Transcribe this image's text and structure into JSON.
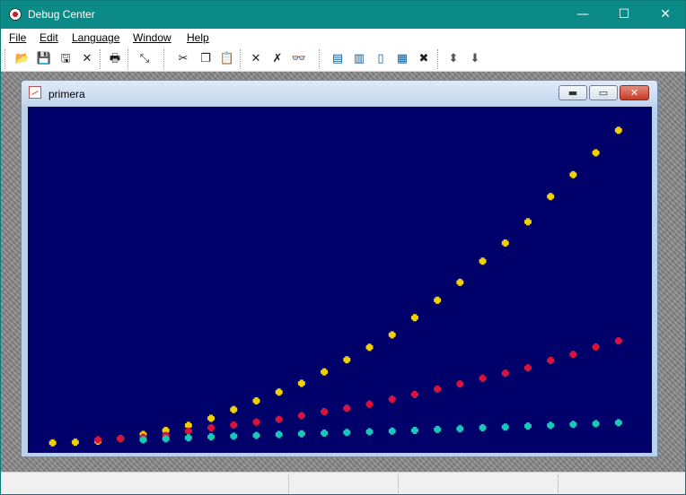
{
  "app": {
    "title": "Debug Center"
  },
  "caption_buttons": {
    "minimize": "—",
    "maximize": "☐",
    "close": "✕"
  },
  "menu": [
    {
      "label": "File"
    },
    {
      "label": "Edit"
    },
    {
      "label": "Language"
    },
    {
      "label": "Window"
    },
    {
      "label": "Help"
    }
  ],
  "toolbar": [
    {
      "name": "open-folder-icon",
      "glyph": "📂"
    },
    {
      "name": "save-icon",
      "glyph": "💾"
    },
    {
      "name": "save-all-icon",
      "glyph": "🖫"
    },
    {
      "name": "close-x-icon",
      "glyph": "✕"
    },
    {
      "name": "print-icon",
      "glyph": "🖶"
    },
    {
      "name": "pointer-icon",
      "glyph": "⤡"
    },
    {
      "name": "cut-icon",
      "glyph": "✂"
    },
    {
      "name": "copy-icon",
      "glyph": "❐"
    },
    {
      "name": "paste-icon",
      "glyph": "📋"
    },
    {
      "name": "delete-icon",
      "glyph": "✕"
    },
    {
      "name": "delete-all-icon",
      "glyph": "✗"
    },
    {
      "name": "find-icon",
      "glyph": "👓"
    },
    {
      "name": "cascade-icon",
      "glyph": "▤"
    },
    {
      "name": "tile-horizontal-icon",
      "glyph": "▥"
    },
    {
      "name": "tile-vertical-icon",
      "glyph": "▯"
    },
    {
      "name": "arrange-icon",
      "glyph": "▦"
    },
    {
      "name": "close-all-icon",
      "glyph": "✖"
    },
    {
      "name": "move-up-icon",
      "glyph": "⬍"
    },
    {
      "name": "move-down-icon",
      "glyph": "⬇"
    }
  ],
  "child_window": {
    "title": "primera",
    "buttons": {
      "minimize": "▬",
      "maximize": "▭",
      "close": "✕"
    }
  },
  "colors": {
    "titlebar": "#0b8a87",
    "plot_background": "#00006b",
    "series_yellow": "#f0d000",
    "series_red": "#d8143c",
    "series_cyan": "#18c8b8"
  },
  "chart_data": {
    "type": "scatter",
    "x": [
      1,
      2,
      3,
      4,
      5,
      6,
      7,
      8,
      9,
      10,
      11,
      12,
      13,
      14,
      15,
      16,
      17,
      18,
      19,
      20,
      21,
      22,
      23,
      24,
      25,
      26
    ],
    "series": [
      {
        "color": "#f0d000",
        "values": [
          0.3,
          0.5,
          0.8,
          1.6,
          2.8,
          4.0,
          5.5,
          7.6,
          10.2,
          12.8,
          15.4,
          18.0,
          21.4,
          25.0,
          28.7,
          32.4,
          37.5,
          42.7,
          48.0,
          54.3,
          59.7,
          66.0,
          73.5,
          80.0,
          86.5,
          93.2
        ]
      },
      {
        "color": "#d8143c",
        "values": [
          1.2,
          1.6,
          2.0,
          2.5,
          3.8,
          4.8,
          5.6,
          6.5,
          7.3,
          8.4,
          9.6,
          10.6,
          11.8,
          13.3,
          14.7,
          16.3,
          17.8,
          19.5,
          21.0,
          22.6,
          24.8,
          26.6,
          28.8,
          30.6
        ]
      },
      {
        "color": "#18c8b8",
        "values": [
          1.2,
          1.5,
          1.8,
          2.1,
          2.3,
          2.5,
          2.8,
          3.0,
          3.2,
          3.4,
          3.6,
          3.8,
          4.0,
          4.3,
          4.5,
          4.8,
          5.0,
          5.3,
          5.5,
          5.8,
          6.0,
          6.3
        ]
      }
    ],
    "series_x_start": [
      1,
      3,
      5
    ],
    "ylim": [
      0,
      97
    ],
    "xlim": [
      0.3,
      27
    ],
    "grid": false
  }
}
